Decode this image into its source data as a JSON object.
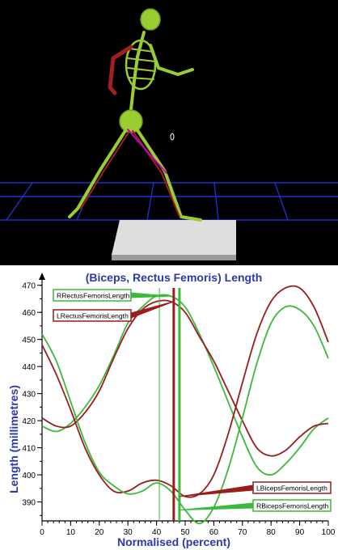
{
  "colors": {
    "background_3d": "#000000",
    "grid": "#1f2fd0",
    "platform": "#d9d9d9",
    "skeleton": "#9acd32",
    "skeleton_red": "#a02020",
    "muscle_magenta": "#c000c0",
    "title_blue": "#2b3aa6",
    "series_red": "#9a1c1c",
    "series_green": "#3cb83c"
  },
  "chart_data": {
    "type": "line",
    "title": "(Biceps, Rectus Femoris) Length",
    "xlabel": "Normalised (percent)",
    "ylabel": "Length (millimetres)",
    "xlim": [
      0,
      100
    ],
    "ylim": [
      383,
      472
    ],
    "xticks": [
      0,
      10,
      20,
      30,
      40,
      50,
      60,
      70,
      80,
      90,
      100
    ],
    "yticks": [
      390,
      400,
      410,
      420,
      430,
      440,
      450,
      460,
      470
    ],
    "grid": false,
    "cursors": [
      {
        "x": 41,
        "color": "#3cb83c",
        "style": "thin"
      },
      {
        "x": 46,
        "color": "#9a1c1c",
        "style": "thick"
      },
      {
        "x": 48,
        "color": "#3cb83c",
        "style": "thick"
      }
    ],
    "series": [
      {
        "name": "RRectusFemorisLength",
        "color": "#3cb83c",
        "x": [
          0,
          5,
          10,
          15,
          20,
          25,
          30,
          35,
          40,
          45,
          50,
          55,
          60,
          65,
          70,
          75,
          80,
          85,
          90,
          95,
          100
        ],
        "values": [
          418,
          416,
          419,
          425,
          433,
          444,
          456,
          462,
          466,
          466,
          462,
          452,
          440,
          427,
          414,
          403,
          400,
          404,
          410,
          417,
          421
        ]
      },
      {
        "name": "LRectusFemorisLength",
        "color": "#9a1c1c",
        "x": [
          0,
          5,
          10,
          15,
          20,
          25,
          30,
          35,
          40,
          45,
          50,
          55,
          60,
          65,
          70,
          75,
          80,
          85,
          90,
          95,
          100
        ],
        "values": [
          421,
          418,
          418,
          423,
          431,
          443,
          454,
          461,
          464,
          464,
          460,
          451,
          442,
          431,
          420,
          410,
          407,
          409,
          414,
          418,
          419
        ]
      },
      {
        "name": "LBicepsFemorisLength",
        "color": "#9a1c1c",
        "x": [
          0,
          5,
          10,
          15,
          20,
          25,
          30,
          35,
          40,
          45,
          50,
          55,
          60,
          65,
          70,
          75,
          80,
          85,
          90,
          95,
          100
        ],
        "values": [
          448,
          437,
          424,
          410,
          400,
          394,
          394,
          397,
          398,
          396,
          392,
          393,
          400,
          415,
          434,
          452,
          464,
          469,
          469,
          462,
          449
        ]
      },
      {
        "name": "RBicepsFemorisLength",
        "color": "#3cb83c",
        "x": [
          0,
          5,
          10,
          15,
          20,
          25,
          30,
          35,
          40,
          45,
          50,
          55,
          60,
          65,
          70,
          75,
          80,
          85,
          90,
          95,
          100
        ],
        "values": [
          452,
          442,
          427,
          412,
          401,
          396,
          393,
          394,
          397,
          394,
          387,
          382,
          388,
          402,
          421,
          441,
          456,
          462,
          461,
          455,
          443
        ]
      }
    ],
    "annotations": [
      {
        "text": "RRectusFemorisLength",
        "series": 0,
        "anchor_x": 45,
        "color": "#3cb83c"
      },
      {
        "text": "LRectusFemorisLength",
        "series": 1,
        "anchor_x": 46,
        "color": "#9a1c1c"
      },
      {
        "text": "LBicepsFemorisLength",
        "series": 2,
        "anchor_x": 48,
        "color": "#9a1c1c"
      },
      {
        "text": "RBicepsFemorisLength",
        "series": 3,
        "anchor_x": 48,
        "color": "#3cb83c"
      }
    ]
  }
}
